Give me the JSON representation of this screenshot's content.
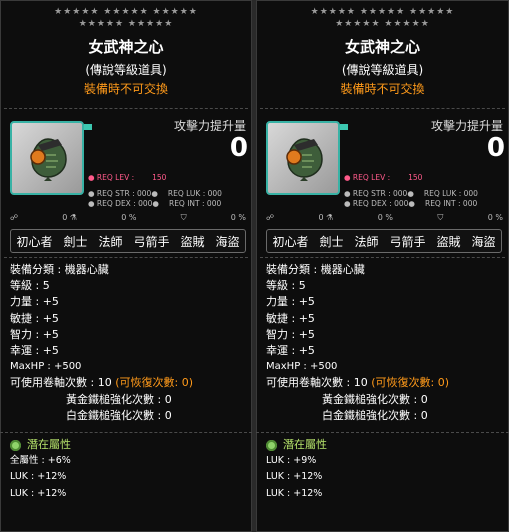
{
  "panels": [
    {
      "stars_row1": "★★★★★ ★★★★★ ★★★★★",
      "stars_row2": "★★★★★ ★★★★★",
      "item_name": "女武神之心",
      "grade": "(傳說等級道具)",
      "trade_note": "裝備時不可交換",
      "attack_label": "攻擊力提升量",
      "attack_value": "0",
      "req_lev_label": "● REQ LEV :",
      "req_lev_value": "150",
      "req_str": "● REQ STR : 000●",
      "req_luk": "REQ LUK : 000",
      "req_dex": "● REQ DEX : 000●",
      "req_int": "REQ INT : 000",
      "misc": [
        "☍",
        "0 ⚗",
        "0 %",
        "⛉",
        "0 %"
      ],
      "jobs": [
        "初心者",
        "劍士",
        "法師",
        "弓箭手",
        "盜賊",
        "海盜"
      ],
      "equip_type": "裝備分類 : 機器心臟",
      "level": "等級 : 5",
      "str": "力量 : +5",
      "dex": "敏捷 : +5",
      "int": "智力 : +5",
      "luk": "幸運 : +5",
      "maxhp": "MaxHP : +500",
      "scroll_slots": "可使用卷軸次數 : 10",
      "restore": "(可恢復次數: 0)",
      "gold_hammer": "黃金鐵槌強化次數 : 0",
      "platinum_hammer": "白金鐵槌強化次數 : 0",
      "potential_title": "潛在屬性",
      "potential": [
        "全屬性 : +6%",
        "LUK : +12%",
        "LUK : +12%"
      ]
    },
    {
      "stars_row1": "★★★★★ ★★★★★ ★★★★★",
      "stars_row2": "★★★★★ ★★★★★",
      "item_name": "女武神之心",
      "grade": "(傳說等級道具)",
      "trade_note": "裝備時不可交換",
      "attack_label": "攻擊力提升量",
      "attack_value": "0",
      "req_lev_label": "● REQ LEV :",
      "req_lev_value": "150",
      "req_str": "● REQ STR : 000●",
      "req_luk": "REQ LUK : 000",
      "req_dex": "● REQ DEX : 000●",
      "req_int": "REQ INT : 000",
      "misc": [
        "☍",
        "0 ⚗",
        "0 %",
        "⛉",
        "0 %"
      ],
      "jobs": [
        "初心者",
        "劍士",
        "法師",
        "弓箭手",
        "盜賊",
        "海盜"
      ],
      "equip_type": "裝備分類 : 機器心臟",
      "level": "等級 : 5",
      "str": "力量 : +5",
      "dex": "敏捷 : +5",
      "int": "智力 : +5",
      "luk": "幸運 : +5",
      "maxhp": "MaxHP : +500",
      "scroll_slots": "可使用卷軸次數 : 10",
      "restore": "(可恢復次數: 0)",
      "gold_hammer": "黃金鐵槌強化次數 : 0",
      "platinum_hammer": "白金鐵槌強化次數 : 0",
      "potential_title": "潛在屬性",
      "potential": [
        "LUK : +9%",
        "LUK : +12%",
        "LUK : +12%"
      ]
    }
  ]
}
